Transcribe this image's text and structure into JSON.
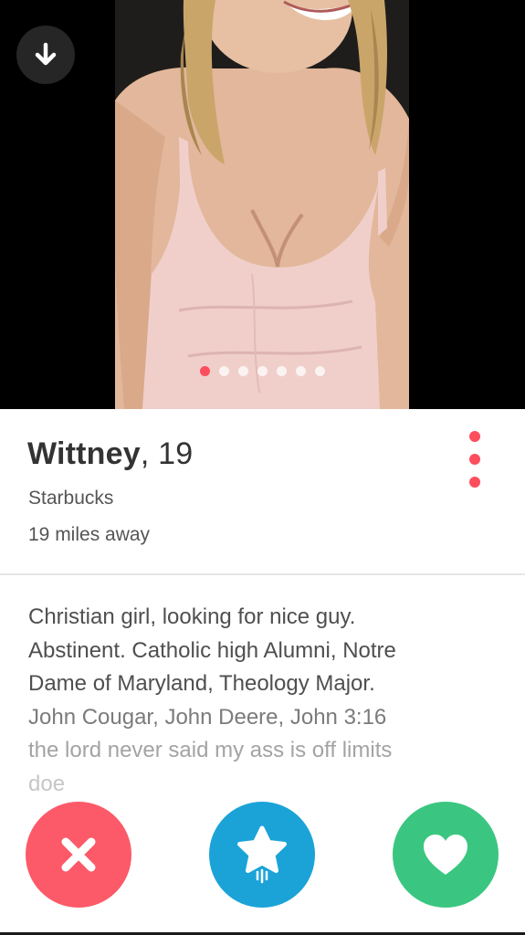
{
  "profile": {
    "name": "Wittney",
    "age": "19",
    "job": "Starbucks",
    "distance": "19 miles away"
  },
  "photos": {
    "count": 7,
    "active_index": 0
  },
  "bio": {
    "lines": [
      "Christian girl, looking for nice guy.",
      "Abstinent. Catholic high Alumni, Notre",
      "Dame of Maryland, Theology Major.",
      "John Cougar, John Deere, John 3:16",
      "the lord never said my ass is off limits",
      "doe"
    ]
  },
  "icons": {
    "back": "arrow-down-icon",
    "more": "more-vertical-icon",
    "nope": "close-icon",
    "superlike": "star-icon",
    "like": "heart-icon"
  },
  "colors": {
    "accent": "#fd4e5d",
    "nope": "#fc5a69",
    "superlike": "#1ba3d8",
    "like": "#3ac680"
  }
}
